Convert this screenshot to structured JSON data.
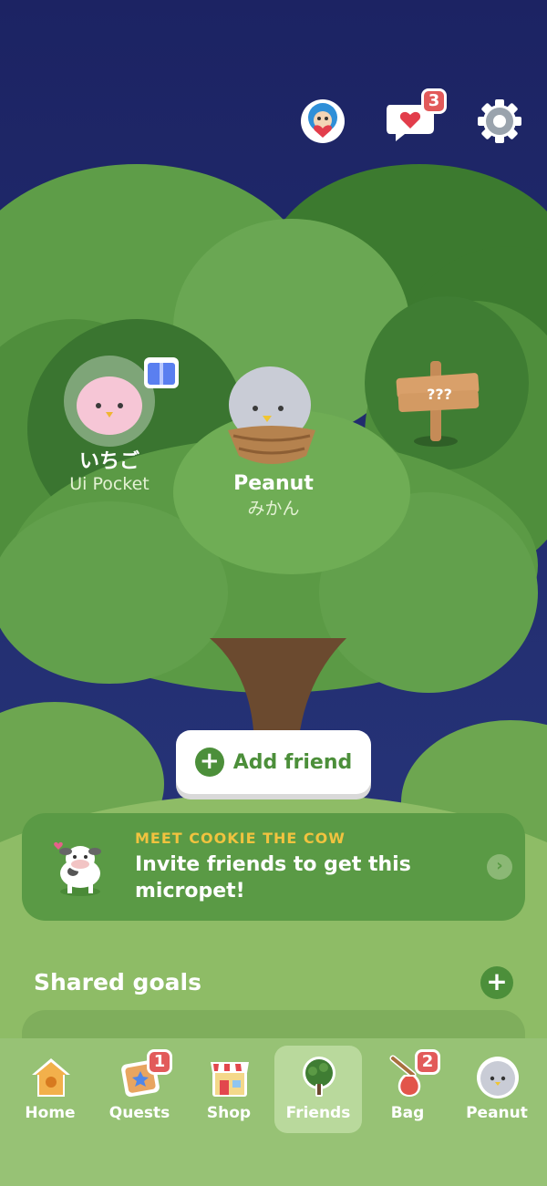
{
  "top_bar": {
    "avatar_icon": "heart-hug-bird-icon",
    "messages_badge": "3",
    "settings_icon": "gear-icon"
  },
  "friends": [
    {
      "name": "いちご",
      "sub": "Ui Pocket",
      "has_gift": true,
      "gift_icon": "gift-icon"
    },
    {
      "name": "Peanut",
      "sub": "みかん"
    }
  ],
  "sign": {
    "text": "???"
  },
  "add_friend": {
    "label": "Add friend"
  },
  "promo": {
    "kicker": "MEET COOKIE THE COW",
    "text": "Invite friends to get this micropet!"
  },
  "shared_goals": {
    "title": "Shared goals",
    "add_label": "+"
  },
  "tabs": [
    {
      "label": "Home",
      "icon": "birdhouse-icon"
    },
    {
      "label": "Quests",
      "icon": "quest-map-icon",
      "badge": "1"
    },
    {
      "label": "Shop",
      "icon": "shop-icon"
    },
    {
      "label": "Friends",
      "icon": "tree-icon",
      "active": true
    },
    {
      "label": "Bag",
      "icon": "bag-icon",
      "badge": "2"
    },
    {
      "label": "Peanut",
      "icon": "pet-avatar-icon"
    }
  ],
  "colors": {
    "sky": "#1f2a6b",
    "tree_dark": "#3f7d33",
    "tree_mid": "#5b9a45",
    "tree_light": "#7ab35e",
    "accent_green": "#4c8f3a",
    "badge_red": "#e25a5a",
    "kicker_yellow": "#f1c33f"
  }
}
